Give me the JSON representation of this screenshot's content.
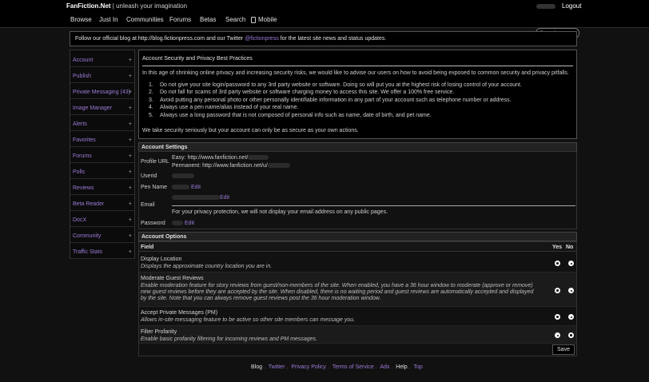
{
  "header": {
    "brand": "FanFiction.Net",
    "tagline": "unleash your imagination",
    "logout": "Logout",
    "search_placeholder": "Search"
  },
  "nav": [
    "Browse",
    "Just In",
    "Communities",
    "Forums",
    "Betas",
    "Search",
    "Mobile"
  ],
  "notice": {
    "prefix": "Follow our official blog at http://blog.fictionpress.com and our Twitter ",
    "handle": "@fictionpress",
    "suffix": " for the latest site news and status updates."
  },
  "sidebar": [
    "Account",
    "Publish",
    "Private Messaging (43)",
    "Image Manager",
    "Alerts",
    "Favorites",
    "Forums",
    "Polls",
    "Reviews",
    "Beta Reader",
    "DocX",
    "Community",
    "Traffic Stats"
  ],
  "best_practices": {
    "title": "Account Security and Privacy Best Practices",
    "intro": "In this age of shrinking online privacy and increasing security risks, we would like to advise our users on how to avoid being exposed to common security and privacy pitfalls.",
    "items": [
      "Do not give your site login/password to any 3rd party website or software. Doing so will put you at the highest risk of losing control of your account.",
      "Do not fall for scams of 3rd party website or software charging money to access this site. We offer a 100% free service.",
      "Avoid putting any personal photo or other personally identifiable information in any part of your account such as telephone number or address.",
      "Always use a pen name/alias instead of your real name.",
      "Always use a long password that is not composed of personal info such as name, date of birth, and pet name."
    ],
    "outro": "We take security seriously but your account can only be as secure as your own actions."
  },
  "account_settings": {
    "title": "Account Settings",
    "profile_label": "Profile URL",
    "easy_label": "Easy:",
    "easy_url": "http://www.fanfiction.net/",
    "permanent_label": "Permanent:",
    "permanent_url": "http://www.fanfiction.net/u/",
    "userid_label": "Userid",
    "penname_label": "Pen Name",
    "email_label": "Email",
    "password_label": "Password",
    "edit": "Edit",
    "email_note": "For your privacy protection, we will not display your email address on any public pages."
  },
  "account_options": {
    "title": "Account Options",
    "col_field": "Field",
    "col_yes": "Yes",
    "col_no": "No",
    "rows": [
      {
        "title": "Display Location",
        "desc": "Displays the approximate country location you are in.",
        "value": "yes"
      },
      {
        "title": "Moderate Guest Reviews",
        "desc": "Enable moderation feature for story reviews from guest/non-members of the site. When enabled, you have a 36 hour window to moderate (approve or remove) new guest reviews before they are accepted by the site. When disabled, there is no waiting period and guest reviews are automatically accepted and displayed by the site. Note that you can always remove guest reviews post the 36 hour moderation window.",
        "value": "yes"
      },
      {
        "title": "Accept Private Messages (PM)",
        "desc": "Allows in-site messaging feature to be active so other site members can message you.",
        "value": "yes"
      },
      {
        "title": "Filter Profanity",
        "desc": "Enable basic profanity filtering for incoming reviews and PM messages.",
        "value": "no"
      }
    ],
    "save": "Save"
  },
  "footer": [
    "Blog",
    "Twitter",
    "Privacy Policy",
    "Terms of Service",
    "Adx",
    "Help",
    "Top"
  ]
}
